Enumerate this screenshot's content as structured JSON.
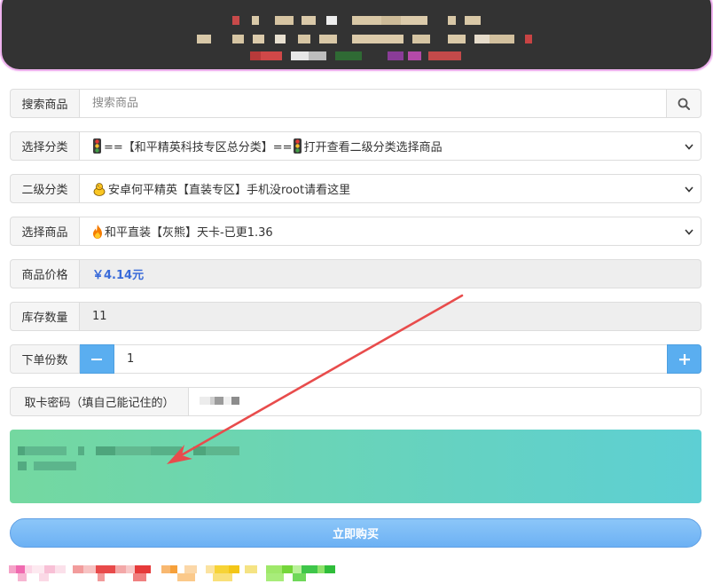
{
  "search": {
    "label": "搜索商品",
    "placeholder": "搜索商品",
    "button_icon": "search-icon"
  },
  "category": {
    "label": "选择分类",
    "selected": {
      "icon": "traffic-light-icon",
      "text_part1": "==【和平精英科技专区总分类】==",
      "icon2": "traffic-light-icon",
      "text_part2": "打开查看二级分类选择商品"
    },
    "dropdown_icon": "chevron-down-icon"
  },
  "subcategory": {
    "label": "二级分类",
    "selected": {
      "icon": "chick-icon",
      "text": "安卓何平精英【直装专区】手机没root请看这里"
    },
    "dropdown_icon": "chevron-down-icon"
  },
  "product": {
    "label": "选择商品",
    "selected": {
      "icon": "fire-icon",
      "text": "和平直装【灰熊】天卡-已更1.36"
    },
    "dropdown_icon": "chevron-down-icon"
  },
  "price": {
    "label": "商品价格",
    "value": "￥4.14元"
  },
  "stock": {
    "label": "库存数量",
    "value": "11"
  },
  "quantity": {
    "label": "下单份数",
    "value": "1",
    "decrement_icon": "minus-icon",
    "increment_icon": "plus-icon"
  },
  "card_password": {
    "label": "取卡密码（填自己能记住的）"
  },
  "buy_button": {
    "label": "立即购买"
  },
  "colors": {
    "accent": "#5aaef0",
    "price": "#3a6bd9",
    "info_start": "#74d8a0",
    "info_end": "#5dcfd4",
    "annotation": "#e84c4c",
    "banner": "#333333",
    "buy_start": "#8cc6f8",
    "buy_end": "#6cb1f4"
  }
}
